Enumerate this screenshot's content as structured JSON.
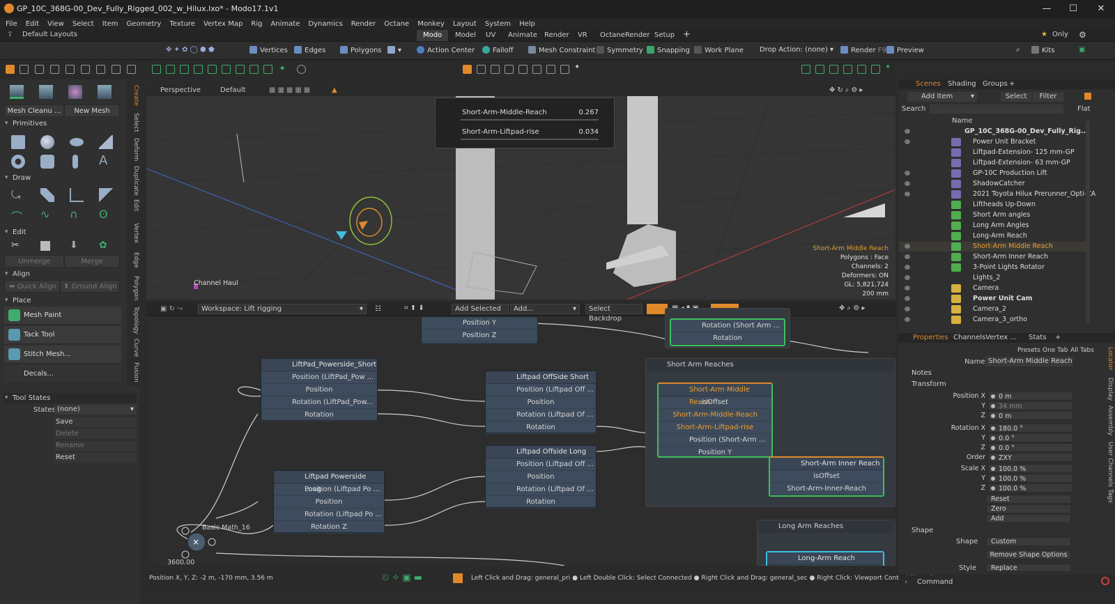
{
  "window": {
    "title": "GP_10C_368G-00_Dev_Fully_Rigged_002_w_Hilux.lxo* - Modo17.1v1",
    "minimize": "—",
    "maximize": "☐",
    "close": "✕"
  },
  "menu": [
    "File",
    "Edit",
    "View",
    "Select",
    "Item",
    "Geometry",
    "Texture",
    "Vertex Map",
    "Rig",
    "Animate",
    "Dynamics",
    "Render",
    "Octane",
    "Monkey",
    "Layout",
    "System",
    "Help"
  ],
  "layout_bar": {
    "default": "Default Layouts",
    "tabs": [
      "Modo",
      "Model",
      "UV",
      "Animate",
      "Render",
      "VR",
      "OctaneRender",
      "Setup"
    ],
    "active": "Modo",
    "add": "+",
    "only": "Only"
  },
  "toolbar": {
    "vertices": "Vertices",
    "edges": "Edges",
    "polygons": "Polygons",
    "action_center": "Action Center",
    "falloff": "Falloff",
    "mesh_constraint": "Mesh Constraint",
    "symmetry": "Symmetry",
    "snapping": "Snapping",
    "work_plane": "Work Plane",
    "drop_action": "Drop Action: (none)",
    "render": "Render",
    "render_key": "F9",
    "preview": "Preview",
    "kits": "Kits"
  },
  "toolbox": {
    "mesh_cleanup": "Mesh Cleanu ...",
    "new_mesh": "New Mesh",
    "primitives": "Primitives",
    "draw": "Draw",
    "edit": "Edit",
    "unmerge": "Unmerge",
    "merge": "Merge",
    "align": "Align",
    "quick_align": "Quick Align",
    "ground_align": "Ground Align",
    "place": "Place",
    "mesh_paint": "Mesh Paint",
    "tack_tool": "Tack Tool",
    "stitch_mesh": "Stitch Mesh...",
    "decals": "Decals...",
    "tool_states": "Tool States",
    "states_label": "States",
    "states_value": "(none)",
    "save": "Save",
    "delete": "Delete",
    "rename": "Rename",
    "reset": "Reset"
  },
  "vtabs": [
    "Create",
    "Select",
    "Deform",
    "Duplicate",
    "Edit",
    "Vertex",
    "Edge",
    "Polygon",
    "Topology",
    "Curve",
    "Fusion"
  ],
  "viewport": {
    "view": "Perspective",
    "shading": "Default",
    "channels": [
      {
        "name": "Short-Arm-Middle-Reach",
        "value": "0.267"
      },
      {
        "name": "Short-Arm-Liftpad-rise",
        "value": "0.034"
      }
    ],
    "label_channel_haul": "Channel Haul",
    "info": [
      "Short-Arm Middle Reach",
      "Polygons : Face",
      "Channels: 2",
      "Deformers: ON",
      "GL: 5,821,724",
      "200 mm"
    ]
  },
  "schematic": {
    "workspace": "Workspace: Lift rigging",
    "add_selected": "Add Selected",
    "add": "Add...",
    "select_backdrop": "Select Backdrop",
    "nodes": {
      "top_a_row": "Position Y",
      "top_a_row2": "Position Z",
      "top_b_row": "Rotation (Short Arm ...",
      "top_b_row2": "Rotation",
      "liftpad_powerside_short": {
        "title": "LiftPad_Powerside_Short",
        "r1": "Position (LiftPad_Pow ...",
        "r2": "Position",
        "r3": "Rotation (LiftPad_Pow...",
        "r4": "Rotation"
      },
      "liftpad_offside_short": {
        "title": "Liftpad OffSide Short",
        "r1": "Position (Liftpad Off ...",
        "r2": "Position",
        "r3": "Rotation (Liftpad Of ...",
        "r4": "Rotation"
      },
      "liftpad_offside_long": {
        "title": "Liftpad Offside Long",
        "r1": "Position (Liftpad Off ...",
        "r2": "Position",
        "r3": "Rotation (Liftpad Of ...",
        "r4": "Rotation"
      },
      "liftpad_powerside_long": {
        "title": "Liftpad Powerside Long",
        "r1": "Position (Liftpad Po ...",
        "r2": "Position",
        "r3": "Rotation (Liftpad Po ...",
        "r4": "Rotation Z"
      },
      "short_arm_reaches": "Short Arm Reaches",
      "short_arm_middle_reach": {
        "title": "Short-Arm Middle Reach",
        "r1": "isOffset",
        "r2": "Short-Arm-Middle-Reach",
        "r3": "Short-Arm-Liftpad-rise",
        "r4": "Position (Short-Arm ...",
        "r5": "Position Y"
      },
      "short_arm_inner_reach": {
        "title": "Short-Arm Inner Reach",
        "r1": "isOffset",
        "r2": "Short-Arm-Inner-Reach"
      },
      "long_arm_reaches": "Long Arm Reaches",
      "long_arm_reach": "Long-Arm Reach",
      "basic_math": "Basic Math_16",
      "math_value": "3600.00"
    }
  },
  "status": {
    "position": "Position X, Y, Z:  -2 m, -170 mm, 3.56 m",
    "hints": "Left Click and Drag: general_pri ● Left Double Click: Select Connected ● Right Click and Drag: general_sec ● Right Click: Viewport Context Menu (pop ..."
  },
  "scenes": {
    "tabs": [
      "Scenes",
      "Shading",
      "Groups",
      "+"
    ],
    "active": "Scenes",
    "add_item": "Add Item",
    "select": "Select",
    "filter": "Filter",
    "search": "Search",
    "flat": "Flat",
    "name_col": "Name",
    "items": [
      {
        "name": "GP_10C_368G-00_Dev_Fully_Rig...",
        "kind": "root"
      },
      {
        "name": "Power Unit Bracket",
        "kind": "mesh"
      },
      {
        "name": "Liftpad-Extension- 125 mm-GP",
        "kind": "mesh"
      },
      {
        "name": "Liftpad-Extension- 63 mm-GP",
        "kind": "mesh"
      },
      {
        "name": "GP-10C Production Lift",
        "kind": "group"
      },
      {
        "name": "ShadowCatcher",
        "kind": "mesh"
      },
      {
        "name": "2021 Toyota Hilux Prerunner_Opti-ZA",
        "kind": "group"
      },
      {
        "name": "Liftheads Up-Down",
        "kind": "locator"
      },
      {
        "name": "Short Arm angles",
        "kind": "locator"
      },
      {
        "name": "Long Arm Angles",
        "kind": "locator"
      },
      {
        "name": "Long-Arm Reach",
        "kind": "locator"
      },
      {
        "name": "Short-Arm Middle Reach",
        "kind": "selected"
      },
      {
        "name": "Short-Arm Inner Reach",
        "kind": "locator"
      },
      {
        "name": "3-Point Lights Rotator",
        "kind": "locator"
      },
      {
        "name": "Lights_2",
        "kind": "group"
      },
      {
        "name": "Camera",
        "kind": "camera"
      },
      {
        "name": "Power Unit Cam",
        "kind": "camera"
      },
      {
        "name": "Camera_2",
        "kind": "camera"
      },
      {
        "name": "Camera_3_ortho",
        "kind": "camera"
      }
    ]
  },
  "properties": {
    "tabs": [
      "Properties",
      "Channels",
      "Vertex ...",
      "Stats",
      "+"
    ],
    "active": "Properties",
    "presets": "Presets",
    "one_tab": "One Tab",
    "all_tabs": "All Tabs",
    "name_label": "Name",
    "name_value": "Short-Arm Middle Reach",
    "notes": "Notes",
    "transform": "Transform",
    "rows": [
      {
        "k": "Position X",
        "v": "0 m"
      },
      {
        "k": "Y",
        "v": "34 mm"
      },
      {
        "k": "Z",
        "v": "0 m"
      },
      {
        "k": "Rotation X",
        "v": "180.0 °"
      },
      {
        "k": "Y",
        "v": "0.0 °"
      },
      {
        "k": "Z",
        "v": "0.0 °"
      },
      {
        "k": "Order",
        "v": "ZXY"
      },
      {
        "k": "Scale X",
        "v": "100.0 %"
      },
      {
        "k": "Y",
        "v": "100.0 %"
      },
      {
        "k": "Z",
        "v": "100.0 %"
      }
    ],
    "reset": "Reset",
    "zero": "Zero",
    "add": "Add",
    "shape_section": "Shape",
    "shape_label": "Shape",
    "shape_value": "Custom",
    "remove_shape": "Remove Shape Options",
    "style_label": "Style",
    "style_value": "Replace",
    "side_tabs": [
      "Locator",
      "Display",
      "Assembly",
      "User Channels",
      "Tags"
    ]
  },
  "command": {
    "label": "Command"
  },
  "colors": {
    "accent": "#e0892a",
    "selection_green": "#3ec05a",
    "node": "#3d4b5c"
  }
}
